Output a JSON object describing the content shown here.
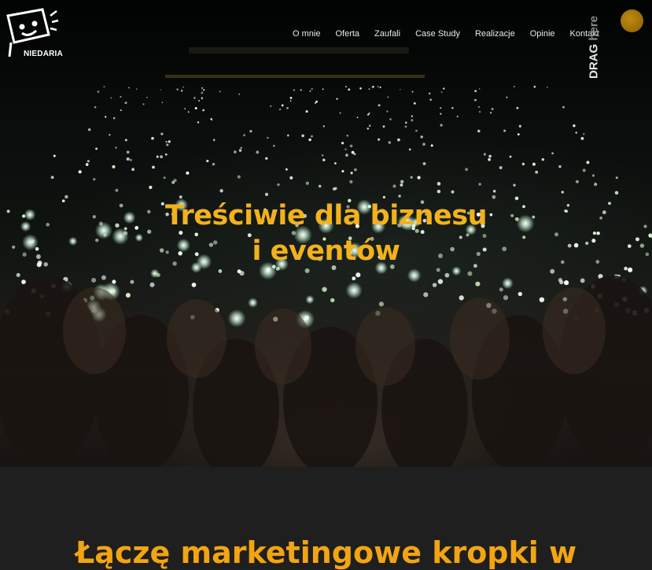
{
  "logo": {
    "text": "NIEDARIA",
    "icon": "logo-icon"
  },
  "nav": {
    "items": [
      {
        "label": "O mnie"
      },
      {
        "label": "Oferta"
      },
      {
        "label": "Zaufali"
      },
      {
        "label": "Case Study"
      },
      {
        "label": "Realizacje"
      },
      {
        "label": "Opinie"
      },
      {
        "label": "Kontakt"
      }
    ]
  },
  "drag": {
    "word1": "DRAG",
    "word2": "here"
  },
  "hero": {
    "line1": "Treściwie dla biznesu",
    "line2": "i eventów"
  },
  "section2": {
    "heading": "Łączę marketingowe kropki w"
  },
  "colors": {
    "accent": "#f2b21b",
    "background": "#1f1f1f"
  }
}
